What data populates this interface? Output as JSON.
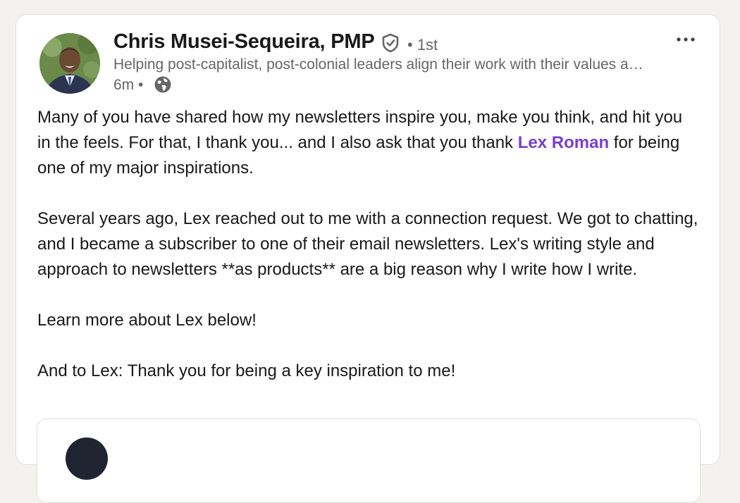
{
  "post": {
    "author": {
      "name": "Chris Musei-Sequeira, PMP",
      "degree": "• 1st",
      "headline": "Helping post-capitalist, post-colonial leaders align their work with their values and build thriving businesses",
      "posted_ago": "6m •"
    },
    "icons": {
      "verified": "verified-shield-icon",
      "visibility": "globe-icon",
      "menu": "more-dots-icon"
    },
    "body": {
      "p1_before": "Many of you have shared how my newsletters inspire you, make you think, and hit you in the feels. For that, I thank you... and I also ask that you thank ",
      "p1_mention": "Lex Roman",
      "p1_after": " for being one of my major inspirations.",
      "p2": "Several years ago, Lex reached out to me with a connection request. We got to chatting, and I became a subscriber to one of their email newsletters. Lex's writing style and approach to newsletters **as products** are a big reason why I write how I write.",
      "p3": "Learn more about Lex below!",
      "p4": "And to Lex: Thank you for being a key inspiration to me!"
    },
    "colors": {
      "mention": "#7a3fc8",
      "text": "#191919",
      "secondary": "#666666",
      "background": "#f4f2ee"
    }
  }
}
